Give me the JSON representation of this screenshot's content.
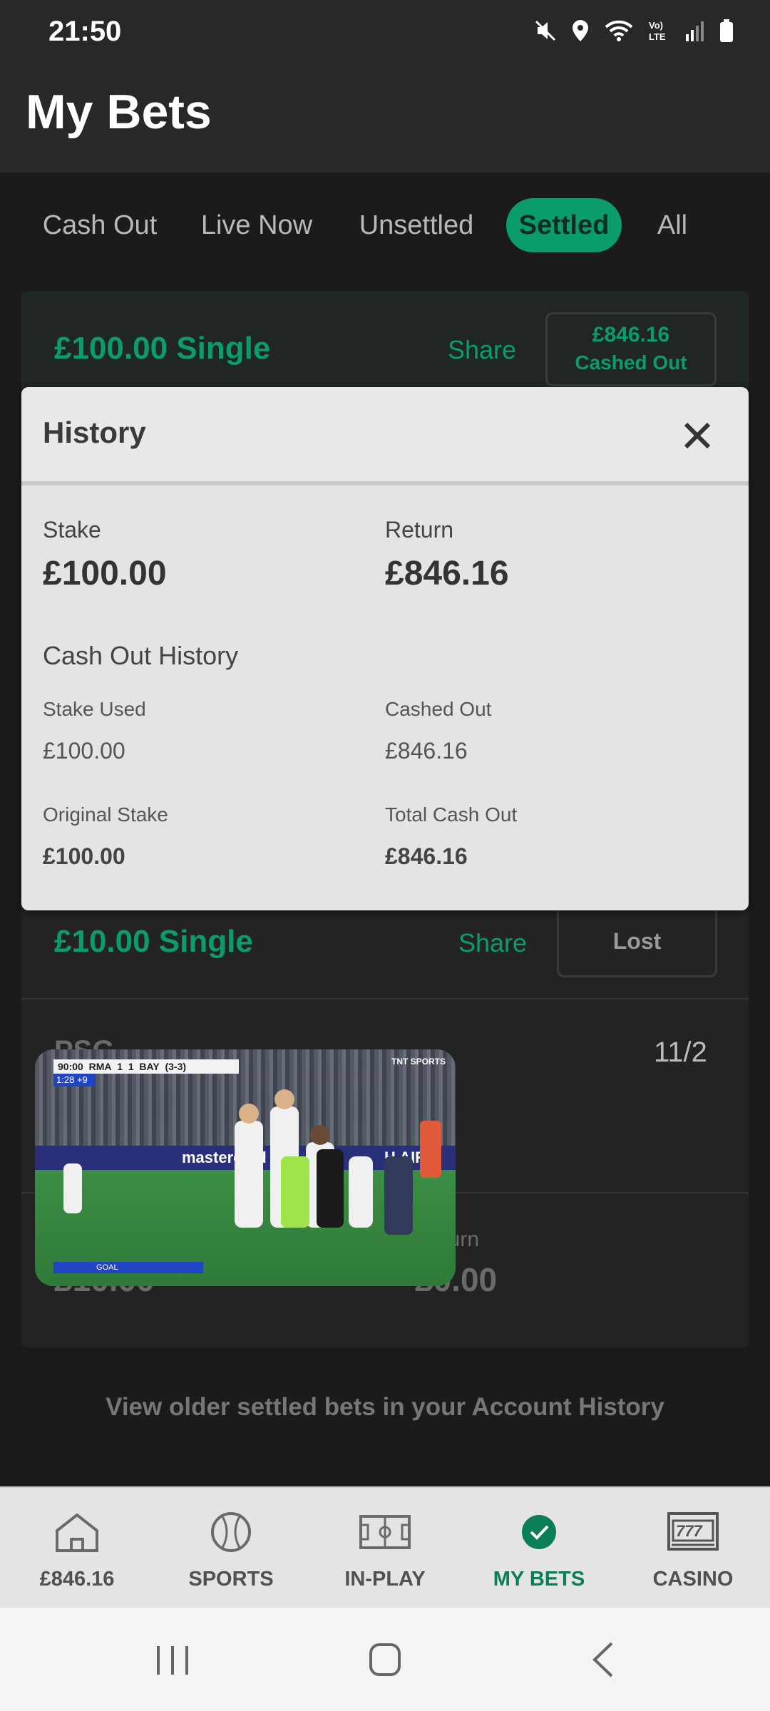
{
  "status_bar": {
    "time": "21:50",
    "icons": [
      "mute-icon",
      "location-icon",
      "wifi-icon",
      "volte-icon",
      "signal-icon",
      "battery-icon"
    ],
    "volte_text": "Vo)\nLTE"
  },
  "header": {
    "title": "My Bets"
  },
  "filters": {
    "tabs": [
      {
        "label": "Cash Out",
        "active": false
      },
      {
        "label": "Live Now",
        "active": false
      },
      {
        "label": "Unsettled",
        "active": false
      },
      {
        "label": "Settled",
        "active": true
      },
      {
        "label": "All",
        "active": false
      }
    ]
  },
  "bets": [
    {
      "title": "£100.00 Single",
      "share_label": "Share",
      "status_amount": "£846.16",
      "status_label": "Cashed Out"
    },
    {
      "title": "£10.00 Single",
      "share_label": "Share",
      "status_label": "Lost",
      "selection": "PSG",
      "odds": "11/2",
      "return_label": "Return",
      "return_value": "£0.00",
      "stake_value": "£10.00"
    }
  ],
  "history_modal": {
    "title": "History",
    "stake_label": "Stake",
    "stake_value": "£100.00",
    "return_label": "Return",
    "return_value": "£846.16",
    "cash_out_section": "Cash Out History",
    "stake_used_label": "Stake Used",
    "stake_used_value": "£100.00",
    "cashed_out_label": "Cashed Out",
    "cashed_out_value": "£846.16",
    "original_stake_label": "Original Stake",
    "original_stake_value": "£100.00",
    "total_cash_out_label": "Total Cash Out",
    "total_cash_out_value": "£846.16"
  },
  "video": {
    "clock": "90:00",
    "home": "RMA",
    "home_score": "1",
    "away_score": "1",
    "away": "BAY",
    "aggregate": "(3-3)",
    "added_time": "1:28",
    "added_plus": "+9",
    "banner_text": "mastercard",
    "banner_text_2": "H AIRL",
    "broadcaster": "TNT SPORTS",
    "goal_label": "GOAL"
  },
  "account_link": "View older settled bets in your Account History",
  "bottom_nav": {
    "items": [
      {
        "label": "£846.16",
        "icon": "home-icon",
        "active": false
      },
      {
        "label": "SPORTS",
        "icon": "ball-icon",
        "active": false
      },
      {
        "label": "IN-PLAY",
        "icon": "pitch-icon",
        "active": false
      },
      {
        "label": "MY BETS",
        "icon": "check-icon",
        "active": true
      },
      {
        "label": "CASINO",
        "icon": "slot-machine-icon",
        "active": false
      }
    ]
  },
  "colors": {
    "accent": "#0a9c6c",
    "background": "#1b1b1b",
    "modal": "#e4e4e4"
  }
}
